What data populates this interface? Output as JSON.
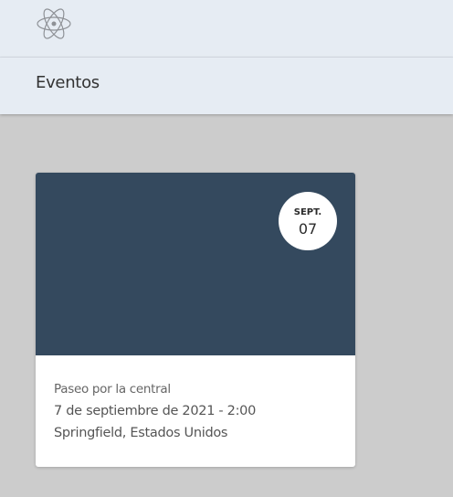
{
  "header": {
    "logo_icon": "atom-logo-icon"
  },
  "subheader": {
    "title": "Eventos"
  },
  "events": [
    {
      "badge_month": "SEPT.",
      "badge_day": "07",
      "name": "Paseo por la central",
      "datetime": "7 de septiembre de 2021 - 2:00",
      "location": "Springfield, Estados Unidos",
      "hero_color": "#34495e"
    }
  ]
}
